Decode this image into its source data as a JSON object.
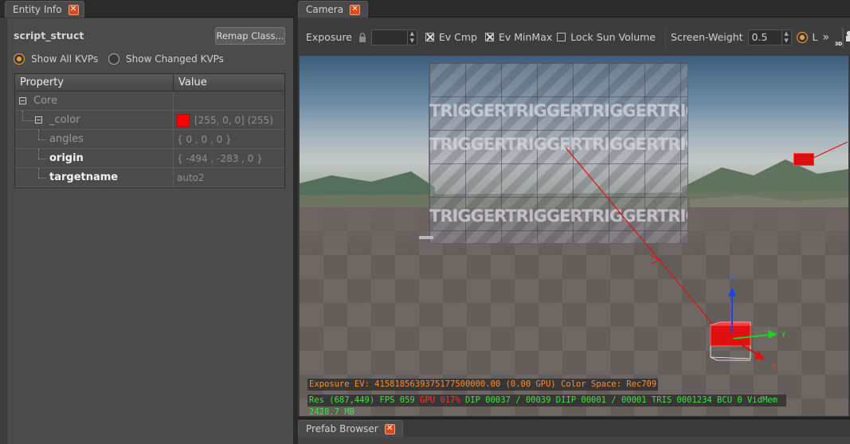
{
  "entity_info": {
    "tab_label": "Entity Info",
    "struct_name": "script_struct",
    "remap_button": "Remap Class...",
    "radio_all": "Show All KVPs",
    "radio_changed": "Show Changed KVPs",
    "selected_radio": "Show All KVPs",
    "columns": {
      "property": "Property",
      "value": "Value"
    },
    "rows": [
      {
        "property": "Core",
        "value": ""
      },
      {
        "property": "_color",
        "value": "[255, 0, 0] (255)",
        "swatch": "#ff0000"
      },
      {
        "property": "angles",
        "value": "{ 0 , 0 , 0 }"
      },
      {
        "property": "origin",
        "value": "{ -494 , -283 , 0 }"
      },
      {
        "property": "targetname",
        "value": "auto2"
      }
    ]
  },
  "camera": {
    "tab_label": "Camera",
    "exposure_label": "Exposure",
    "ev_cmp_label": "Ev Cmp",
    "ev_cmp_checked": true,
    "ev_minmax_label": "Ev MinMax",
    "ev_minmax_checked": true,
    "lock_sun_label": "Lock Sun Volume",
    "lock_sun_checked": false,
    "screen_weight_label": "Screen-Weight",
    "screen_weight_value": "0.5",
    "l_label": "L",
    "more_glyph": "»",
    "view_mode_badge": "3D",
    "wall_text": "TRIGGERTRIGGERTRIGGERTRIGGERTRIG",
    "gizmo_labels": {
      "z": "Z",
      "y": "Y",
      "x": "X"
    },
    "overlay_exposure": "Exposure EV: 4158185639375177500000.00 (0.00 GPU)  Color Space: Rec709",
    "overlay_stats_a": "Res (687,449)   FPS 059   ",
    "overlay_stats_gpu": "GPU 017%",
    "overlay_stats_b": "   DIP 00037 / 00039  DIIP 00001 / 00001  TRIS 0001234  BCU 0  VidMem 2428.7 MB",
    "colors": {
      "accent": "#f0a030",
      "close_tab": "#d94b1a",
      "stat_green": "#38e838",
      "stat_red": "#ff3030",
      "exposure_orange": "#ff8c2a"
    }
  },
  "prefab_browser": {
    "tab_label": "Prefab Browser"
  }
}
